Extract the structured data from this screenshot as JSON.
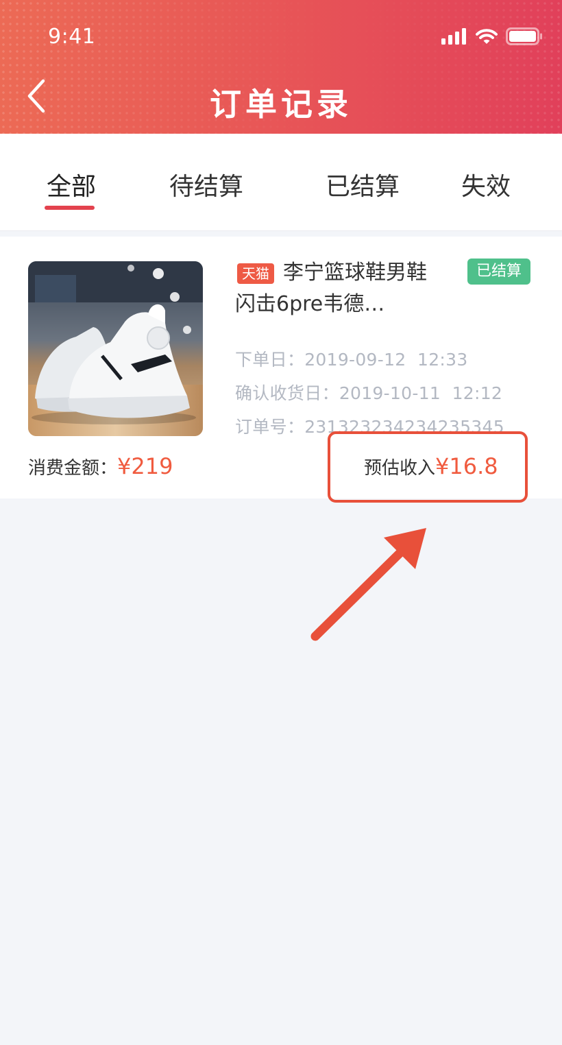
{
  "status_bar": {
    "time": "9:41",
    "icons": [
      "signal-icon",
      "wifi-icon",
      "battery-icon"
    ]
  },
  "header": {
    "title": "订单记录",
    "back_icon": "chevron-left-icon",
    "gradient": [
      "#ec6a55",
      "#e1405a"
    ]
  },
  "tabs": [
    {
      "label": "全部",
      "active": true
    },
    {
      "label": "待结算",
      "active": false
    },
    {
      "label": "已结算",
      "active": false
    },
    {
      "label": "失效",
      "active": false
    }
  ],
  "order": {
    "platform_tag": "天猫",
    "title": "李宁篮球鞋男鞋闪击6pre韦德…",
    "status_badge": "已结算",
    "order_date_label": "下单日：",
    "order_date": "2019-09-12  12:33",
    "receipt_date_label": "确认收货日：",
    "receipt_date": "2019-10-11  12:12",
    "order_no_label": "订单号：",
    "order_no": "231323234234235345",
    "spend_label": "消费金额：",
    "spend_value": "¥219",
    "income_label": "预估收入",
    "income_value": "¥16.8"
  },
  "colors": {
    "accent": "#e3424e",
    "price": "#f05b3f",
    "settled_badge": "#4fc08b",
    "tmall_tag": "#ee5a45",
    "annotation": "#e8503a"
  }
}
